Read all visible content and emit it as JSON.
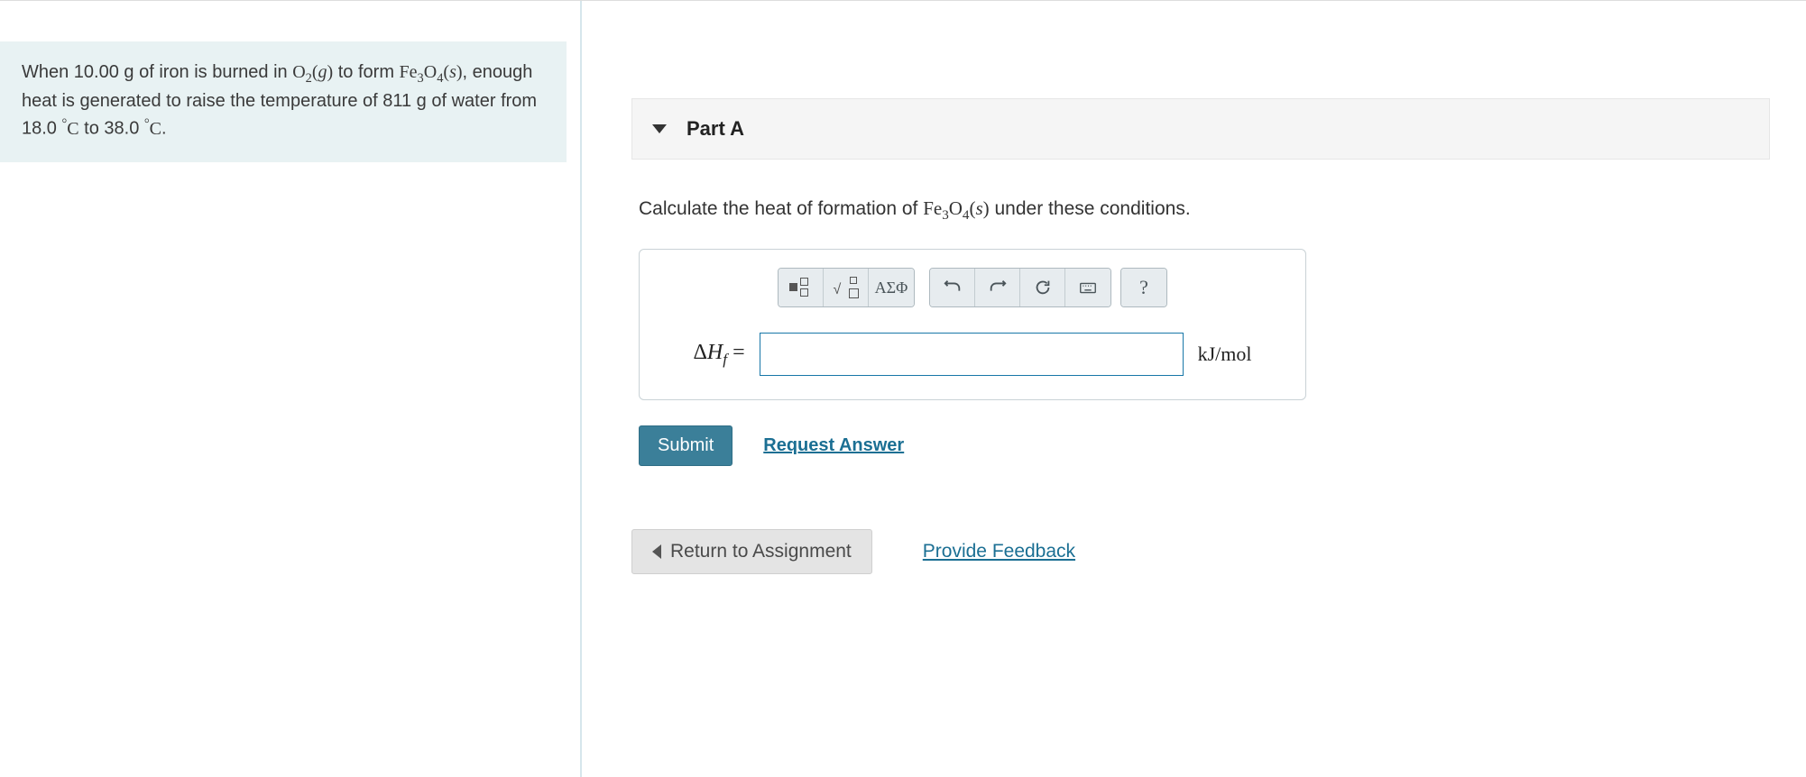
{
  "problem": {
    "text_before_o2": "When 10.00 g of iron is burned in ",
    "o2": "O",
    "o2_sub": "2",
    "o2_phase": "g",
    "text_mid1": " to form ",
    "fe": "Fe",
    "fe_sub1": "3",
    "o": "O",
    "o_sub2": "4",
    "feo_phase": "s",
    "text_mid2": ", enough heat is generated to raise the temperature of 811 g of water from 18.0 ",
    "deg": "°",
    "c1": "C",
    "text_mid3": " to 38.0 ",
    "c2": "C",
    "end": "."
  },
  "part": {
    "label": "Part A",
    "question_prefix": "Calculate the heat of formation of ",
    "fe": "Fe",
    "fe_sub1": "3",
    "o": "O",
    "o_sub2": "4",
    "phase": "s",
    "question_suffix": " under these conditions."
  },
  "toolbar": {
    "greek": "ΑΣΦ",
    "help": "?"
  },
  "input": {
    "lhs_delta": "Δ",
    "lhs_H": "H",
    "lhs_sub": "f",
    "lhs_eq": " = ",
    "value": "",
    "units": "kJ/mol"
  },
  "buttons": {
    "submit": "Submit",
    "request": "Request Answer",
    "return": "Return to Assignment",
    "feedback": "Provide Feedback"
  }
}
